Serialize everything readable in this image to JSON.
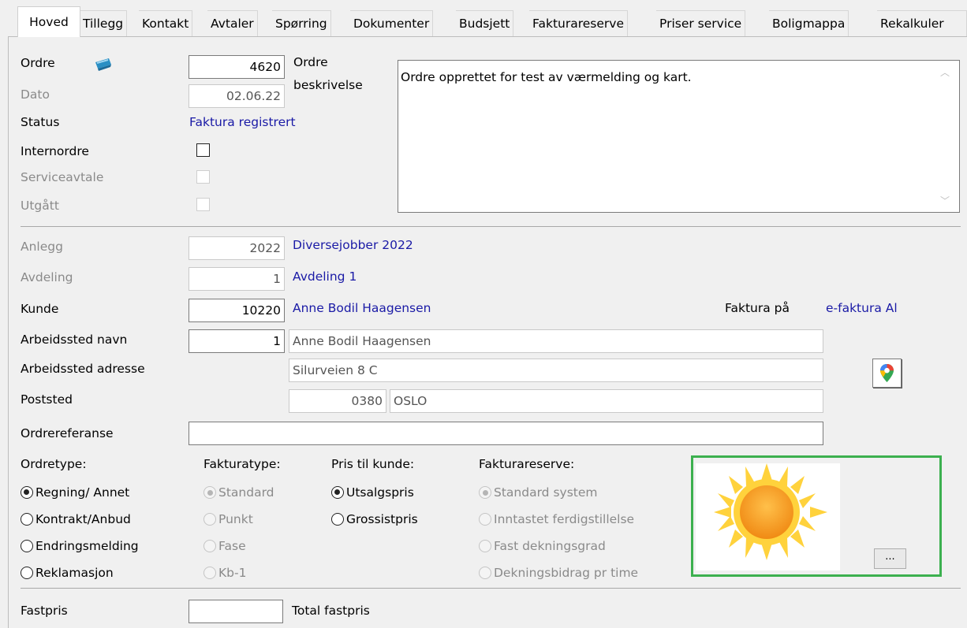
{
  "tabs": [
    "Hoved",
    "Tillegg",
    "Kontakt",
    "Avtaler",
    "Spørring",
    "Dokumenter",
    "Budsjett",
    "Fakturareserve",
    "Priser service",
    "Boligmappa",
    "Rekalkuler"
  ],
  "order": {
    "ordre_label": "Ordre",
    "ordre_value": "4620",
    "beskrivelse_label_1": "Ordre",
    "beskrivelse_label_2": "beskrivelse",
    "beskrivelse_text": "Ordre opprettet for test av værmelding og kart.",
    "dato_label": "Dato",
    "dato_value": "02.06.22",
    "status_label": "Status",
    "status_value": "Faktura registrert",
    "internordre_label": "Internordre",
    "serviceavtale_label": "Serviceavtale",
    "utgatt_label": "Utgått"
  },
  "details": {
    "anlegg_label": "Anlegg",
    "anlegg_value": "2022",
    "anlegg_name": "Diversejobber 2022",
    "avdeling_label": "Avdeling",
    "avdeling_value": "1",
    "avdeling_name": "Avdeling 1",
    "kunde_label": "Kunde",
    "kunde_value": "10220",
    "kunde_name": "Anne Bodil Haagensen",
    "faktura_pa_label": "Faktura på",
    "faktura_pa_value": "e-faktura Al",
    "arbeidssted_navn_label": "Arbeidssted navn",
    "arbeidssted_navn_nr": "1",
    "arbeidssted_navn_value": "Anne Bodil Haagensen",
    "arbeidssted_adresse_label": "Arbeidssted adresse",
    "arbeidssted_adresse_value": "Silurveien 8 C",
    "poststed_label": "Poststed",
    "postnr": "0380",
    "poststed_value": "OSLO",
    "ordrereferanse_label": "Ordrereferanse",
    "ordrereferanse_value": ""
  },
  "groups": {
    "ordretype": {
      "title": "Ordretype:",
      "options": [
        "Regning/ Annet",
        "Kontrakt/Anbud",
        "Endringsmelding",
        "Reklamasjon"
      ],
      "selected": "Regning/ Annet"
    },
    "fakturatype": {
      "title": "Fakturatype:",
      "options": [
        "Standard",
        "Punkt",
        "Fase",
        "Kb-1"
      ],
      "selected": "Standard"
    },
    "pris": {
      "title": "Pris til kunde:",
      "options": [
        "Utsalgspris",
        "Grossistpris"
      ],
      "selected": "Utsalgspris"
    },
    "fakturareserve": {
      "title": "Fakturareserve:",
      "options": [
        "Standard system",
        "Inntastet ferdigstillelse",
        "Fast dekningsgrad",
        "Dekningsbidrag pr time"
      ],
      "selected": "Standard system"
    }
  },
  "weather": {
    "icon": "sun-icon",
    "button_label": "..."
  },
  "footer": {
    "fastpris_label": "Fastpris",
    "fastpris_value": "",
    "total_fastpris_label": "Total fastpris"
  },
  "colors": {
    "link_blue": "#1a1aa6",
    "weather_border": "#3cb04f"
  }
}
